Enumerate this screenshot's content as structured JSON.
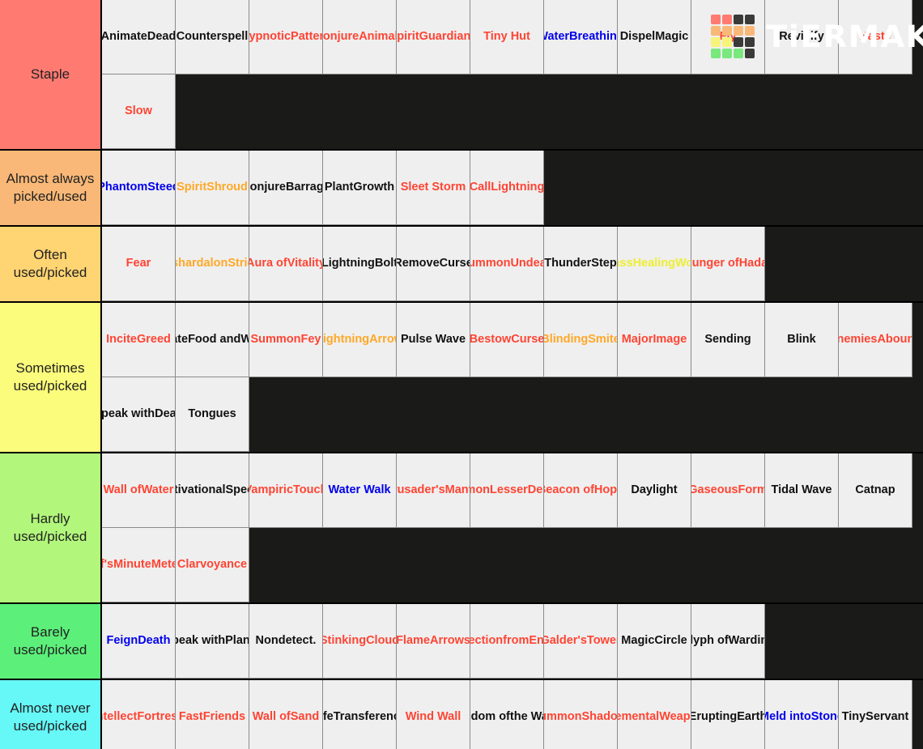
{
  "brand": {
    "logo_name": "tiermaker-logo",
    "wordmark": "TiERMAKER",
    "grid_colors": [
      "#ff7b72",
      "#ff7b72",
      "#3a3a38",
      "#3a3a38",
      "#f9b877",
      "#f9b877",
      "#f9b877",
      "#f9b877",
      "#f7f47c",
      "#f7f47c",
      "#3a3a38",
      "#3a3a38",
      "#79e87d",
      "#79e87d",
      "#79e87d",
      "#3a3a38"
    ]
  },
  "palette": {
    "tile_bg": "#efefef",
    "board_bg": "#1a1a18",
    "red": "#ff4433",
    "black": "#111111",
    "blue": "#0000ee",
    "orange": "#ffa826",
    "yellow": "#eeee33"
  },
  "tiers": [
    {
      "label": "Staple",
      "color": "#ff7b72",
      "items": [
        {
          "name": "Animate Dead",
          "lines": [
            "Animate",
            "Dead"
          ],
          "color": "black"
        },
        {
          "name": "Counterspell",
          "lines": [
            "Counterspell"
          ],
          "color": "black"
        },
        {
          "name": "Hypnotic Pattern",
          "lines": [
            "Hypnotic",
            "Pattern"
          ],
          "color": "red"
        },
        {
          "name": "Conjure Animals",
          "lines": [
            "Conjure",
            "Animals"
          ],
          "color": "red"
        },
        {
          "name": "Spirit Guardians",
          "lines": [
            "Spirit",
            "Guardians"
          ],
          "color": "red"
        },
        {
          "name": "Tiny Hut",
          "lines": [
            "Tiny Hut"
          ],
          "color": "red"
        },
        {
          "name": "Water Breathing",
          "lines": [
            "Water",
            "Breathing"
          ],
          "color": "blue"
        },
        {
          "name": "Dispel Magic",
          "lines": [
            "Dispel",
            "Magic"
          ],
          "color": "black"
        },
        {
          "name": "Fly",
          "lines": [
            "Fly"
          ],
          "color": "red"
        },
        {
          "name": "Revivify",
          "lines": [
            "Revivify"
          ],
          "color": "black"
        },
        {
          "name": "Haste",
          "lines": [
            "Haste"
          ],
          "color": "red"
        },
        {
          "name": "Slow",
          "lines": [
            "Slow"
          ],
          "color": "red"
        }
      ]
    },
    {
      "label": "Almost always picked/used",
      "color": "#f9b877",
      "items": [
        {
          "name": "Phantom Steed",
          "lines": [
            "Phantom",
            "Steed"
          ],
          "color": "blue"
        },
        {
          "name": "Spirit Shroud",
          "lines": [
            "Spirit",
            "Shroud"
          ],
          "color": "orange"
        },
        {
          "name": "Conjure Barrage",
          "lines": [
            "Conjure",
            "Barrage"
          ],
          "color": "black"
        },
        {
          "name": "Plant Growth",
          "lines": [
            "Plant",
            "Growth"
          ],
          "color": "black"
        },
        {
          "name": "Sleet Storm",
          "lines": [
            "Sleet Storm"
          ],
          "color": "red"
        },
        {
          "name": "Call Lightning",
          "lines": [
            "Call",
            "Lightning"
          ],
          "color": "red"
        }
      ]
    },
    {
      "label": "Often used/picked",
      "color": "#ffd472",
      "items": [
        {
          "name": "Fear",
          "lines": [
            "Fear"
          ],
          "color": "red"
        },
        {
          "name": "Ashardalon Stride",
          "lines": [
            "Ashardalon",
            "Stride"
          ],
          "color": "orange"
        },
        {
          "name": "Aura of Vitality",
          "lines": [
            "Aura of",
            "Vitality"
          ],
          "color": "red"
        },
        {
          "name": "Lightning Bolt",
          "lines": [
            "Lightning",
            "Bolt"
          ],
          "color": "black"
        },
        {
          "name": "Remove Curse",
          "lines": [
            "Remove",
            "Curse"
          ],
          "color": "black"
        },
        {
          "name": "Summon Undead",
          "lines": [
            "Summon",
            "Undead"
          ],
          "color": "red"
        },
        {
          "name": "Thunder Step",
          "lines": [
            "Thunder",
            "Step"
          ],
          "color": "black"
        },
        {
          "name": "Mass Healing Word",
          "lines": [
            "Mass",
            "Healing",
            "Word"
          ],
          "color": "yellow"
        },
        {
          "name": "Hunger of Hadar",
          "lines": [
            "Hunger of",
            "Hadar"
          ],
          "color": "red"
        }
      ]
    },
    {
      "label": "Sometimes used/picked",
      "color": "#fbfb7c",
      "items": [
        {
          "name": "Incite Greed",
          "lines": [
            "Incite",
            "Greed"
          ],
          "color": "red"
        },
        {
          "name": "Create Food and Water",
          "lines": [
            "Create",
            "Food and",
            "Water"
          ],
          "color": "black"
        },
        {
          "name": "Summon Fey",
          "lines": [
            "Summon",
            "Fey"
          ],
          "color": "red"
        },
        {
          "name": "Lightning Arrow",
          "lines": [
            "Lightning",
            "Arrow"
          ],
          "color": "orange"
        },
        {
          "name": "Pulse Wave",
          "lines": [
            "Pulse Wave"
          ],
          "color": "black"
        },
        {
          "name": "Bestow Curse",
          "lines": [
            "Bestow",
            "Curse"
          ],
          "color": "red"
        },
        {
          "name": "Blinding Smite",
          "lines": [
            "Blinding",
            "Smite"
          ],
          "color": "orange"
        },
        {
          "name": "Major Image",
          "lines": [
            "Major",
            "Image"
          ],
          "color": "red"
        },
        {
          "name": "Sending",
          "lines": [
            "Sending"
          ],
          "color": "black"
        },
        {
          "name": "Blink",
          "lines": [
            "Blink"
          ],
          "color": "black"
        },
        {
          "name": "Enemies Abound",
          "lines": [
            "Enemies",
            "Abound"
          ],
          "color": "red"
        },
        {
          "name": "Speak with Dead",
          "lines": [
            "Speak with",
            "Dead"
          ],
          "color": "black"
        },
        {
          "name": "Tongues",
          "lines": [
            "Tongues"
          ],
          "color": "black"
        }
      ]
    },
    {
      "label": "Hardly used/picked",
      "color": "#b2f77c",
      "items": [
        {
          "name": "Wall of Water",
          "lines": [
            "Wall of",
            "Water"
          ],
          "color": "red"
        },
        {
          "name": "Motivational Speech",
          "lines": [
            "Motivational",
            "Speech"
          ],
          "color": "black"
        },
        {
          "name": "Vampiric Touch",
          "lines": [
            "Vampiric",
            "Touch"
          ],
          "color": "red"
        },
        {
          "name": "Water Walk",
          "lines": [
            "Water Walk"
          ],
          "color": "blue"
        },
        {
          "name": "Crusader's Mantle",
          "lines": [
            "Crusader's",
            "Mantle"
          ],
          "color": "red"
        },
        {
          "name": "Summon Lesser Demons",
          "lines": [
            "Summon",
            "Lesser",
            "Demons"
          ],
          "color": "red"
        },
        {
          "name": "Beacon of Hope",
          "lines": [
            "Beacon of",
            "Hope"
          ],
          "color": "red"
        },
        {
          "name": "Daylight",
          "lines": [
            "Daylight"
          ],
          "color": "black"
        },
        {
          "name": "Gaseous Form",
          "lines": [
            "Gaseous",
            "Form"
          ],
          "color": "red"
        },
        {
          "name": "Tidal Wave",
          "lines": [
            "Tidal Wave"
          ],
          "color": "black"
        },
        {
          "name": "Catnap",
          "lines": [
            "Catnap"
          ],
          "color": "black"
        },
        {
          "name": "Melf's Minute Meteors",
          "lines": [
            "Melf's",
            "Minute",
            "Meteors"
          ],
          "color": "red"
        },
        {
          "name": "Clarvoyance",
          "lines": [
            "Clarvoyance"
          ],
          "color": "red"
        }
      ]
    },
    {
      "label": "Barely used/picked",
      "color": "#5cf07a",
      "items": [
        {
          "name": "Feign Death",
          "lines": [
            "Feign",
            "Death"
          ],
          "color": "blue"
        },
        {
          "name": "Speak with Plants",
          "lines": [
            "Speak with",
            "Plants"
          ],
          "color": "black"
        },
        {
          "name": "Nondetect.",
          "lines": [
            "Nondetect."
          ],
          "color": "black"
        },
        {
          "name": "Stinking Cloud",
          "lines": [
            "Stinking",
            "Cloud"
          ],
          "color": "red"
        },
        {
          "name": "Flame Arrows",
          "lines": [
            "Flame",
            "Arrows"
          ],
          "color": "red"
        },
        {
          "name": "Protection from Energy",
          "lines": [
            "Protection",
            "from",
            "Energy"
          ],
          "color": "red"
        },
        {
          "name": "Galder's Tower",
          "lines": [
            "Galder's",
            "Tower"
          ],
          "color": "red"
        },
        {
          "name": "Magic Circle",
          "lines": [
            "Magic",
            "Circle"
          ],
          "color": "black"
        },
        {
          "name": "Glyph of Warding",
          "lines": [
            "Glyph of",
            "Warding"
          ],
          "color": "black"
        }
      ]
    },
    {
      "label": "Almost never used/picked",
      "color": "#66f7f7",
      "items": [
        {
          "name": "Intellect Fortress",
          "lines": [
            "Intellect",
            "Fortress"
          ],
          "color": "red"
        },
        {
          "name": "Fast Friends",
          "lines": [
            "Fast",
            "Friends"
          ],
          "color": "red"
        },
        {
          "name": "Wall of Sand",
          "lines": [
            "Wall of",
            "Sand"
          ],
          "color": "red"
        },
        {
          "name": "Life Transference",
          "lines": [
            "Life",
            "Transference"
          ],
          "color": "black"
        },
        {
          "name": "Wind Wall",
          "lines": [
            "Wind Wall"
          ],
          "color": "red"
        },
        {
          "name": "Freedom of the Waves",
          "lines": [
            "Freedom of",
            "the Waves"
          ],
          "color": "black"
        },
        {
          "name": "Summon Shadow.",
          "lines": [
            "Summon",
            "Shadow."
          ],
          "color": "red"
        },
        {
          "name": "Elemental Weapon",
          "lines": [
            "Elemental",
            "Weapon"
          ],
          "color": "red"
        },
        {
          "name": "Erupting Earth",
          "lines": [
            "Erupting",
            "Earth"
          ],
          "color": "black"
        },
        {
          "name": "Meld into Stone",
          "lines": [
            "Meld into",
            "Stone"
          ],
          "color": "blue"
        },
        {
          "name": "Tiny Servant",
          "lines": [
            "Tiny",
            "Servant"
          ],
          "color": "black"
        }
      ]
    }
  ]
}
